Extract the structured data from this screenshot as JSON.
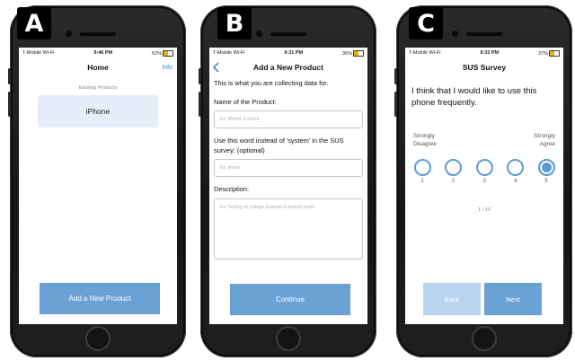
{
  "panels": {
    "a": {
      "letter": "A",
      "status": {
        "carrier": "T-Mobile Wi-Fi",
        "time": "9:46 PM",
        "battery": "52%"
      },
      "nav_title": "Home",
      "nav_right": "Info",
      "section_label": "Existing Products",
      "product": "iPhone",
      "add_button": "Add a New Product"
    },
    "b": {
      "letter": "B",
      "status": {
        "carrier": "T-Mobile Wi-Fi",
        "time": "9:31 PM",
        "battery": "35%"
      },
      "nav_title": "Add a New Product",
      "intro": "This is what you are collecting data for.",
      "name_label": "Name of the Product:",
      "name_placeholder": "Ex: iPhone X Notch",
      "word_label": "Use this word instead of 'system' in the SUS survey: (optional)",
      "word_placeholder": "Ex: phone",
      "desc_label": "Description:",
      "desc_placeholder": "Ex: Testing on college students in portrait mode",
      "continue_button": "Continue"
    },
    "c": {
      "letter": "C",
      "status": {
        "carrier": "T-Mobile Wi-Fi",
        "time": "9:33 PM",
        "battery": "37%"
      },
      "nav_title": "SUS Survey",
      "question": "I think that I would like to use this phone frequently.",
      "left_anchor": "Strongly\nDisagree",
      "right_anchor": "Strongly\nAgree",
      "options": [
        "1",
        "2",
        "3",
        "4",
        "5"
      ],
      "selected": "5",
      "progress": "1 / 10",
      "back_button": "Back",
      "next_button": "Next"
    }
  },
  "colors": {
    "accent": "#6aa2d6",
    "card": "#e3eef9",
    "back_disabled": "#b9d4ee"
  }
}
